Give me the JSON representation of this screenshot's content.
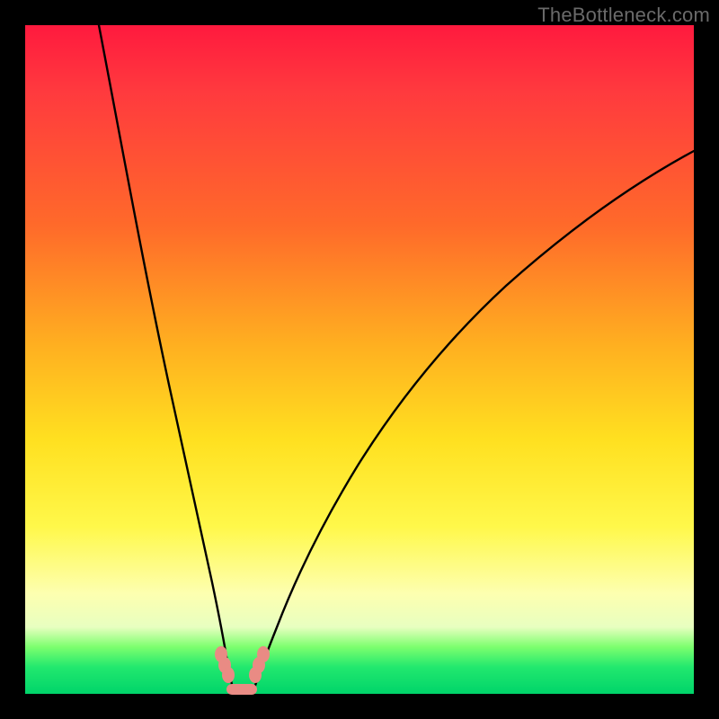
{
  "watermark": "TheBottleneck.com",
  "colors": {
    "frame": "#000000",
    "gradient_top": "#ff1a3e",
    "gradient_mid": "#ffe020",
    "gradient_bottom": "#00d46a",
    "curve": "#000000",
    "marker": "#e98b84"
  },
  "chart_data": {
    "type": "line",
    "title": "",
    "xlabel": "",
    "ylabel": "",
    "xlim": [
      0,
      100
    ],
    "ylim": [
      0,
      100
    ],
    "series": [
      {
        "name": "left-curve",
        "x": [
          11,
          14,
          17,
          20,
          23,
          25,
          26.5,
          27.5,
          28.5,
          29.3,
          30
        ],
        "values": [
          100,
          82,
          64,
          46,
          30,
          18,
          12,
          8.5,
          5.5,
          3,
          1.5
        ]
      },
      {
        "name": "right-curve",
        "x": [
          33,
          34,
          35.5,
          38,
          41,
          45,
          50,
          56,
          63,
          72,
          82,
          92,
          100
        ],
        "values": [
          1.5,
          3,
          6,
          11,
          18,
          27,
          37,
          47,
          56,
          65,
          73,
          79,
          83
        ]
      }
    ],
    "annotations": {
      "left_cluster_markers": [
        {
          "x": 28.8,
          "y": 5.2
        },
        {
          "x": 29.3,
          "y": 3.8
        },
        {
          "x": 29.8,
          "y": 2.5
        }
      ],
      "right_cluster_markers": [
        {
          "x": 33.2,
          "y": 2.5
        },
        {
          "x": 33.8,
          "y": 4.0
        },
        {
          "x": 34.5,
          "y": 5.5
        }
      ],
      "bottom_pill": {
        "x_start": 29.7,
        "x_end": 33.3,
        "y": 0.8
      }
    }
  }
}
